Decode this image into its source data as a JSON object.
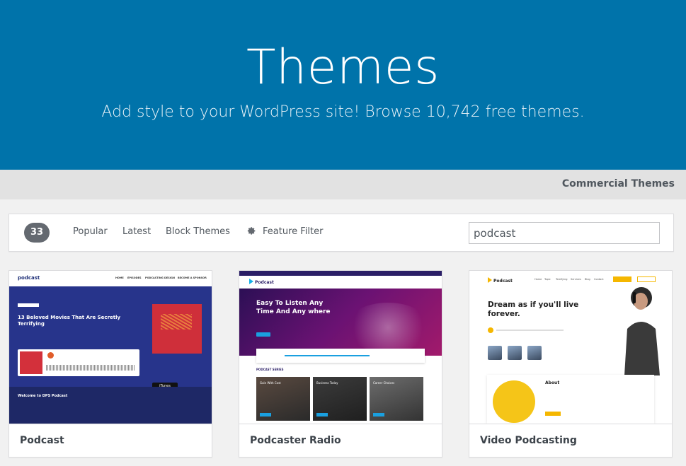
{
  "header": {
    "title": "Themes",
    "subtitle": "Add style to your WordPress site! Browse 10,742 free themes."
  },
  "subnav": {
    "commercial_label": "Commercial Themes"
  },
  "filter": {
    "count": "33",
    "tabs": [
      "Popular",
      "Latest",
      "Block Themes"
    ],
    "feature_filter_label": "Feature Filter",
    "search_value": "podcast"
  },
  "themes": [
    {
      "name": "Podcast",
      "preview": {
        "logo": "podcast",
        "nav": [
          "HOME",
          "EPISODES",
          "PODCASTING DESIGN",
          "BECOME A SPONSOR"
        ],
        "headline": "13 Beloved Movies That Are Secretly Terrifying",
        "itunes": "iTunes",
        "lower_heading": "Welcome to DPS Podcast"
      }
    },
    {
      "name": "Podcaster Radio",
      "preview": {
        "logo": "Podcast",
        "headline": "Easy To Listen Any Time And Any where",
        "section": "PODCAST SERIES",
        "tiles": [
          "Gain With Cost",
          "Business Today",
          "Career Choices"
        ]
      }
    },
    {
      "name": "Video Podcasting",
      "preview": {
        "logo": "Podcast",
        "nav": [
          "Home",
          "Topic",
          "Testifying",
          "Services",
          "Blog",
          "Contact"
        ],
        "headline": "Dream as if you'll live forever.",
        "about": "About"
      }
    }
  ],
  "colors": {
    "hero_bg": "#0073aa",
    "badge_bg": "#646970",
    "page_bg": "#f1f1f1"
  }
}
